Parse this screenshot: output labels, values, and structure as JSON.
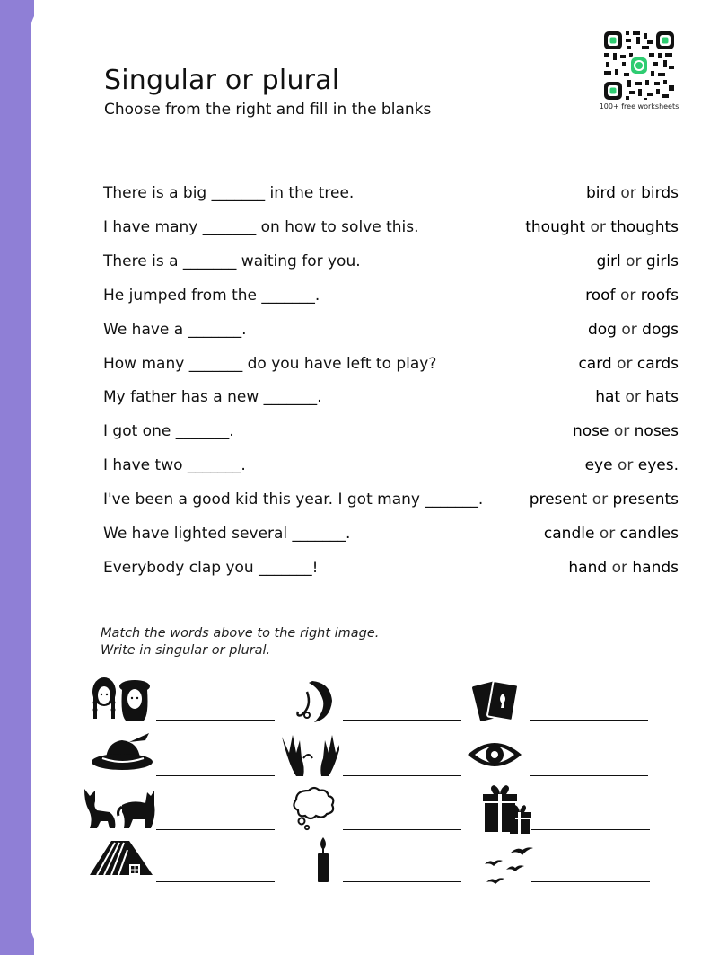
{
  "header": {
    "title": "Singular or plural",
    "subtitle": "Choose from the right and fill in the blanks",
    "qr_caption": "100+ free worksheets"
  },
  "questions": [
    {
      "sentence": "There is a big _______ in the tree.",
      "singular": "bird",
      "or": "or",
      "plural": "birds"
    },
    {
      "sentence": "I have many _______ on how to solve this.",
      "singular": "thought",
      "or": "or",
      "plural": "thoughts"
    },
    {
      "sentence": "There is a _______ waiting for you.",
      "singular": "girl",
      "or": "or",
      "plural": "girls"
    },
    {
      "sentence": "He jumped from the _______.",
      "singular": "roof",
      "or": "or",
      "plural": "roofs"
    },
    {
      "sentence": "We have a _______.",
      "singular": "dog",
      "or": "or",
      "plural": "dogs"
    },
    {
      "sentence": "How many _______ do you have left to play?",
      "singular": "card",
      "or": "or",
      "plural": "cards"
    },
    {
      "sentence": "My father has a new _______.",
      "singular": "hat",
      "or": "or",
      "plural": "hats"
    },
    {
      "sentence": "I got one _______.",
      "singular": "nose",
      "or": "or",
      "plural": "noses"
    },
    {
      "sentence": "I have two _______.",
      "singular": "eye",
      "or": "or",
      "plural": "eyes."
    },
    {
      "sentence": "I've been a good kid this year. I got many _______.",
      "singular": "present",
      "or": "or",
      "plural": "presents"
    },
    {
      "sentence": "We have lighted several _______.",
      "singular": "candle",
      "or": "or",
      "plural": "candles"
    },
    {
      "sentence": "Everybody clap you _______!",
      "singular": "hand",
      "or": "or",
      "plural": "hands"
    }
  ],
  "instructions": {
    "line1": "Match the words above to the right image.",
    "line2": "Write in singular or plural."
  },
  "match_icons": [
    "girls-icon",
    "nose-icon",
    "cards-icon",
    "hat-icon",
    "hands-icon",
    "eye-icon",
    "dogs-icon",
    "thought-icon",
    "presents-icon",
    "roof-icon",
    "candle-icon",
    "birds-icon"
  ],
  "colors": {
    "side_bar": "#8f7fd6",
    "qr_accent": "#2ecc71"
  }
}
